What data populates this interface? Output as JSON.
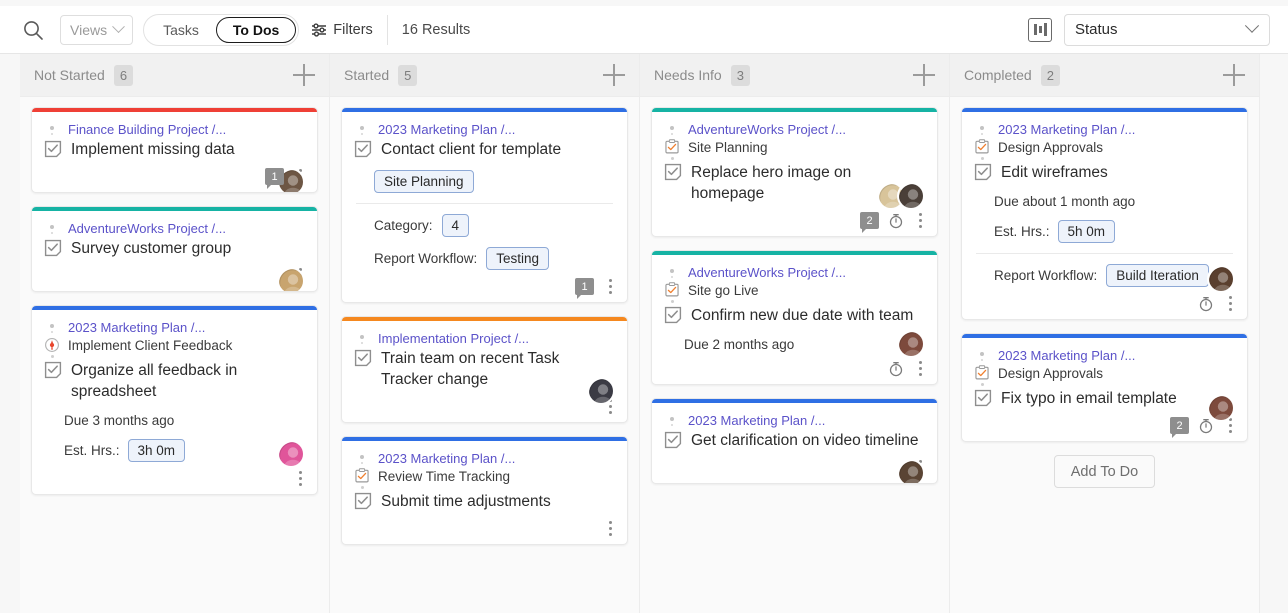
{
  "toolbar": {
    "search_icon": "search-icon",
    "views_label": "Views",
    "segment": [
      {
        "label": "Tasks",
        "active": false
      },
      {
        "label": "To Dos",
        "active": true
      }
    ],
    "filters_label": "Filters",
    "results_label": "16 Results",
    "board_icon": "board-view-icon",
    "status_select_value": "Status"
  },
  "columns": [
    {
      "title": "Not Started",
      "count": "6",
      "cards": [
        {
          "bar_color": "#ef4036",
          "breadcrumb": "Finance Building Project /...",
          "parent": null,
          "title": "Implement missing data",
          "due": null,
          "est_label": null,
          "est_value": null,
          "tag": null,
          "fields": [],
          "avatars": [
            "#6d5644"
          ],
          "comments": "1",
          "timer": false
        },
        {
          "bar_color": "#16b3a4",
          "breadcrumb": "AdventureWorks Project /...",
          "parent": null,
          "title": "Survey customer group",
          "due": null,
          "est_label": null,
          "est_value": null,
          "tag": null,
          "fields": [],
          "avatars": [
            "#c8a46e"
          ],
          "comments": null,
          "timer": false
        },
        {
          "bar_color": "#2f6fe4",
          "breadcrumb": "2023 Marketing Plan /...",
          "parent": "Implement Client Feedback",
          "parent_icon": "milestone-icon",
          "title": "Organize all feedback in spreadsheet",
          "due": "Due 3 months ago",
          "est_label": "Est. Hrs.:",
          "est_value": "3h 0m",
          "tag": null,
          "fields": [],
          "avatars": [
            "#e0559a"
          ],
          "comments": null,
          "timer": false
        }
      ]
    },
    {
      "title": "Started",
      "count": "5",
      "cards": [
        {
          "bar_color": "#2f6fe4",
          "breadcrumb": "2023 Marketing Plan /...",
          "parent": null,
          "title": "Contact client for template",
          "due": null,
          "est_label": null,
          "est_value": null,
          "tag": "Site Planning",
          "fields": [
            {
              "label": "Category:",
              "value": "4"
            },
            {
              "label": "Report Workflow:",
              "value": "Testing"
            }
          ],
          "avatars": [],
          "comments": "1",
          "timer": false
        },
        {
          "bar_color": "#f5881f",
          "breadcrumb": "Implementation Project /...",
          "parent": null,
          "title": "Train team on recent Task Tracker change",
          "due": null,
          "est_label": null,
          "est_value": null,
          "tag": null,
          "fields": [],
          "avatars": [
            "#3b3b44"
          ],
          "comments": null,
          "timer": false
        },
        {
          "bar_color": "#2f6fe4",
          "breadcrumb": "2023 Marketing Plan /...",
          "parent": "Review Time Tracking",
          "parent_icon": "task-icon",
          "title": "Submit time adjustments",
          "due": null,
          "est_label": null,
          "est_value": null,
          "tag": null,
          "fields": [],
          "avatars": [],
          "comments": null,
          "timer": false
        }
      ]
    },
    {
      "title": "Needs Info",
      "count": "3",
      "cards": [
        {
          "bar_color": "#16b3a4",
          "breadcrumb": "AdventureWorks Project /...",
          "parent": "Site Planning",
          "parent_icon": "task-icon",
          "title": "Replace hero image on homepage",
          "due": null,
          "est_label": null,
          "est_value": null,
          "tag": null,
          "fields": [],
          "avatars": [
            "#d8c49a",
            "#4a3f38"
          ],
          "comments": "2",
          "timer": true
        },
        {
          "bar_color": "#16b3a4",
          "breadcrumb": "AdventureWorks Project /...",
          "parent": "Site go Live",
          "parent_icon": "task-icon",
          "title": "Confirm new due date with team",
          "due": "Due 2 months ago",
          "est_label": null,
          "est_value": null,
          "tag": null,
          "fields": [],
          "avatars": [
            "#7d4a3c"
          ],
          "comments": null,
          "timer": true
        },
        {
          "bar_color": "#2f6fe4",
          "breadcrumb": "2023 Marketing Plan /...",
          "parent": null,
          "title": "Get clarification on video timeline",
          "due": null,
          "est_label": null,
          "est_value": null,
          "tag": null,
          "fields": [],
          "avatars": [
            "#5a4434"
          ],
          "comments": null,
          "timer": false
        }
      ]
    },
    {
      "title": "Completed",
      "count": "2",
      "cards": [
        {
          "bar_color": "#2f6fe4",
          "breadcrumb": "2023 Marketing Plan /...",
          "parent": "Design Approvals",
          "parent_icon": "task-icon",
          "title": "Edit wireframes",
          "due": "Due about 1 month ago",
          "est_label": "Est. Hrs.:",
          "est_value": "5h 0m",
          "tag": null,
          "fields": [
            {
              "label": "Report Workflow:",
              "value": "Build Iteration"
            }
          ],
          "avatars": [
            "#5a3f2e"
          ],
          "comments": null,
          "timer": true
        },
        {
          "bar_color": "#2f6fe4",
          "breadcrumb": "2023 Marketing Plan /...",
          "parent": "Design Approvals",
          "parent_icon": "task-icon",
          "title": "Fix typo in email template",
          "due": null,
          "est_label": null,
          "est_value": null,
          "tag": null,
          "fields": [],
          "avatars": [
            "#7d4a3c"
          ],
          "comments": "2",
          "timer": true
        }
      ],
      "add_todo_label": "Add To Do"
    }
  ],
  "colors": {
    "link": "#5b52c9",
    "red_bar": "#ef4036",
    "teal_bar": "#16b3a4",
    "blue_bar": "#2f6fe4",
    "orange_bar": "#f5881f",
    "pill_border": "#8ea9d6"
  }
}
